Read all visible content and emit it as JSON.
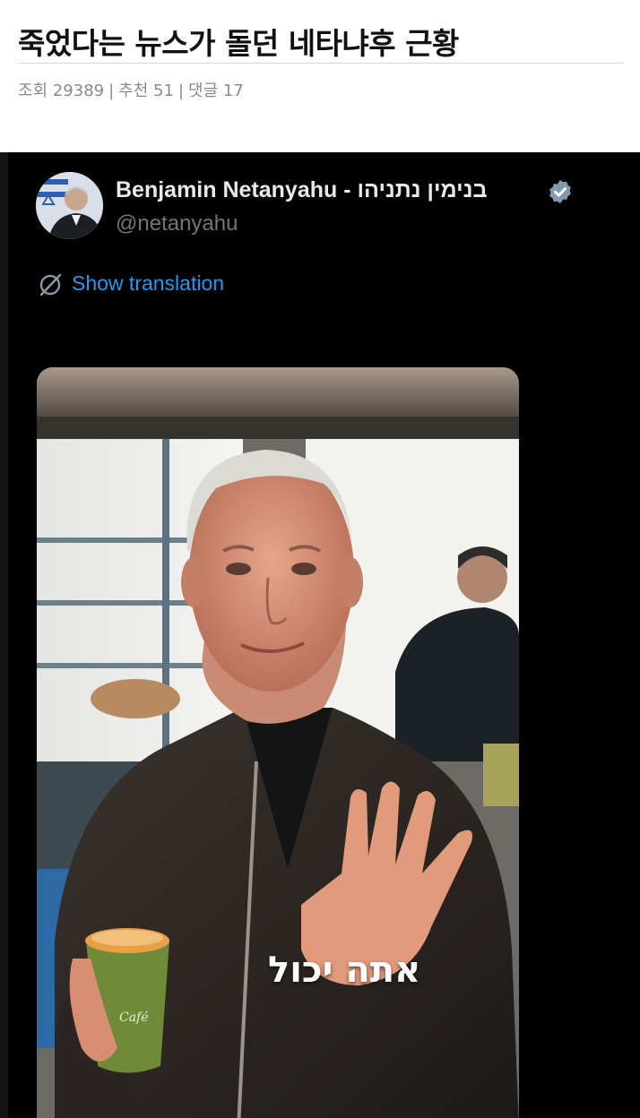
{
  "post": {
    "title": "죽었다는 뉴스가 돌던 네타냐후 근황",
    "views_label": "조회 29389",
    "recommend_label": "추천 51",
    "comments_label": "댓글 17",
    "separator": "|"
  },
  "tweet": {
    "display_name": "Benjamin Netanyahu - בנימין נתניהו",
    "handle": "@netanyahu",
    "translation_label": "Show translation",
    "video_caption": "אתה יכול",
    "icons": {
      "verified": "verified-badge-icon",
      "translate": "globe-icon"
    },
    "colors": {
      "background": "#000000",
      "link": "#1d9bf0",
      "handle": "#71767b",
      "name": "#e7e9ea"
    }
  }
}
